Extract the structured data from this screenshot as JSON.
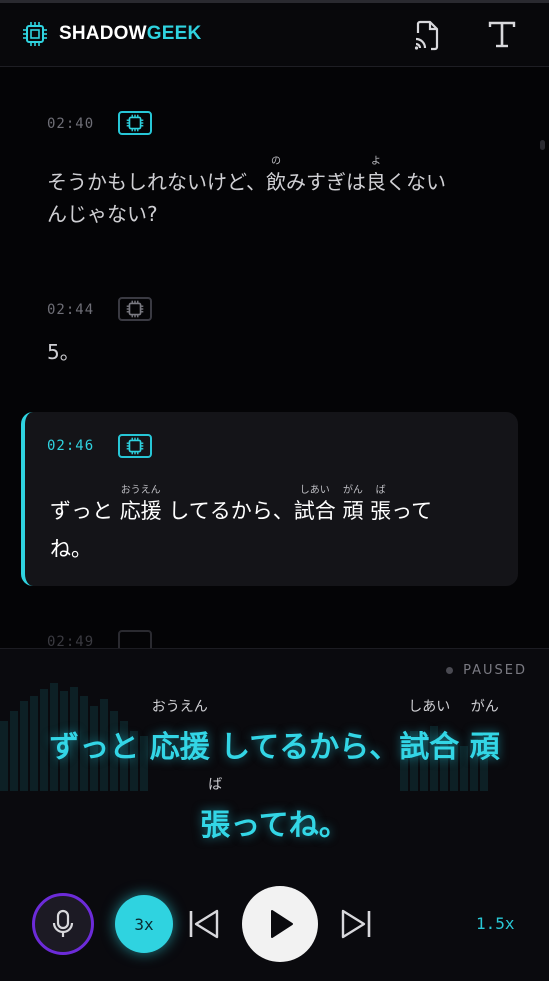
{
  "header": {
    "brand_a": "SHADOW",
    "brand_b": "GEEK",
    "icons": [
      "chip-icon",
      "cast-icon",
      "text-size-icon"
    ]
  },
  "entries": [
    {
      "time": "02:40",
      "badge": "chip-icon",
      "active": true,
      "line1": "そうかもしれないけど、",
      "k1": "飲",
      "k1_r": "の",
      "line1b": "みすぎは",
      "k2": "良",
      "k2_r": "よ",
      "line1c": "くない",
      "line2": "んじゃない?"
    },
    {
      "time": "02:44",
      "badge": "chip-icon",
      "text": "5。"
    },
    {
      "time": "02:46",
      "badge": "chip-icon",
      "p1": "ずっと ",
      "k1": "応援",
      "k1_r": "おうえん",
      "p2": "してるから、",
      "k2": "試合",
      "k2_r": "しあい",
      "k3": "頑",
      "k3_r": "がん",
      "k4": "張",
      "k4_r": "ば",
      "p3": "って",
      "line2": "ね。"
    },
    {
      "time": "02:49"
    }
  ],
  "player": {
    "status": "PAUSED",
    "line1_a": "ずっと ",
    "line1_k1": "応援",
    "line1_k1_r": "おうえん",
    "line1_b": "してるから、",
    "line1_k2": "試合",
    "line1_k2_r": "しあい",
    "line1_k3": "頑",
    "line1_k3_r": "がん",
    "line2_k": "張",
    "line2_k_r": "ば",
    "line2_b": "ってね。",
    "repeat_label": "3x",
    "speed_label": "1.5x",
    "accent": "#2fd3e0",
    "mic_ring": "#6c2bd9"
  }
}
